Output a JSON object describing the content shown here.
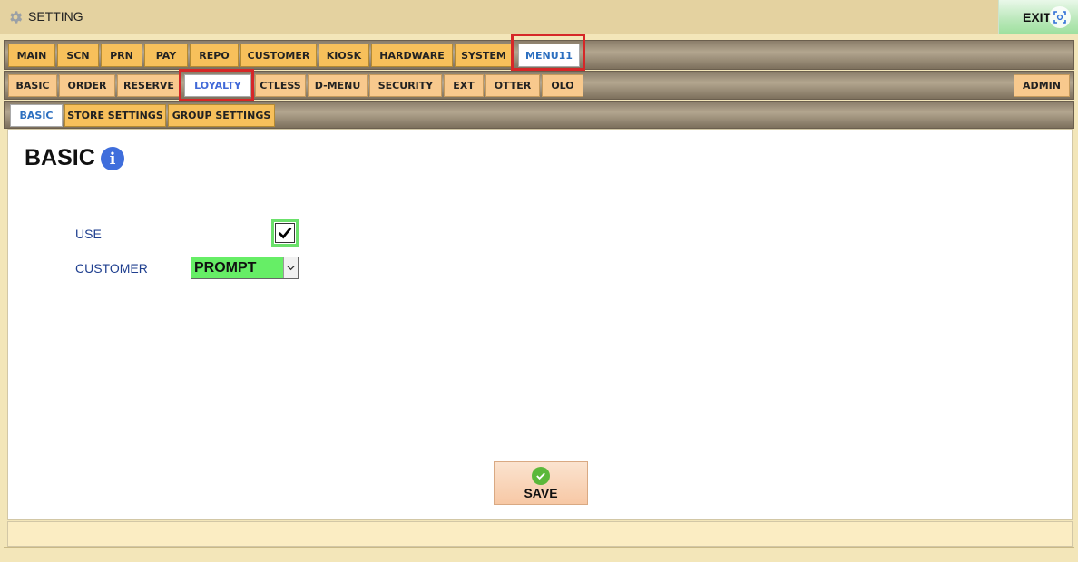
{
  "window": {
    "title": "SETTING",
    "exit_label": "EXIT",
    "gear_icon": "gear-icon",
    "scan_icon": "screenshot-scan-icon"
  },
  "tabs_main": [
    "MAIN",
    "SCN",
    "PRN",
    "PAY",
    "REPO",
    "CUSTOMER",
    "KIOSK",
    "HARDWARE",
    "SYSTEM",
    "MENU11"
  ],
  "tabs_main_active": "MENU11",
  "tabs_sub": [
    "BASIC",
    "ORDER",
    "RESERVE",
    "LOYALTY",
    "CTLESS",
    "D-MENU",
    "SECURITY",
    "EXT",
    "OTTER",
    "OLO"
  ],
  "tabs_sub_active": "LOYALTY",
  "tabs_sub_right": "ADMIN",
  "tabs_section": [
    "BASIC",
    "STORE SETTINGS",
    "GROUP SETTINGS"
  ],
  "tabs_section_active": "BASIC",
  "content": {
    "title": "BASIC",
    "info_icon": "info-icon",
    "use_label": "USE",
    "use_checked": true,
    "customer_label": "CUSTOMER",
    "customer_value": "PROMPT"
  },
  "actions": {
    "save_label": "SAVE",
    "save_icon": "check-circle-icon"
  },
  "colors": {
    "active_tab_text": "#2c6fc0",
    "highlight": "#d62728",
    "select_bg": "#66ee66",
    "checkbox_border": "#6be16b"
  }
}
